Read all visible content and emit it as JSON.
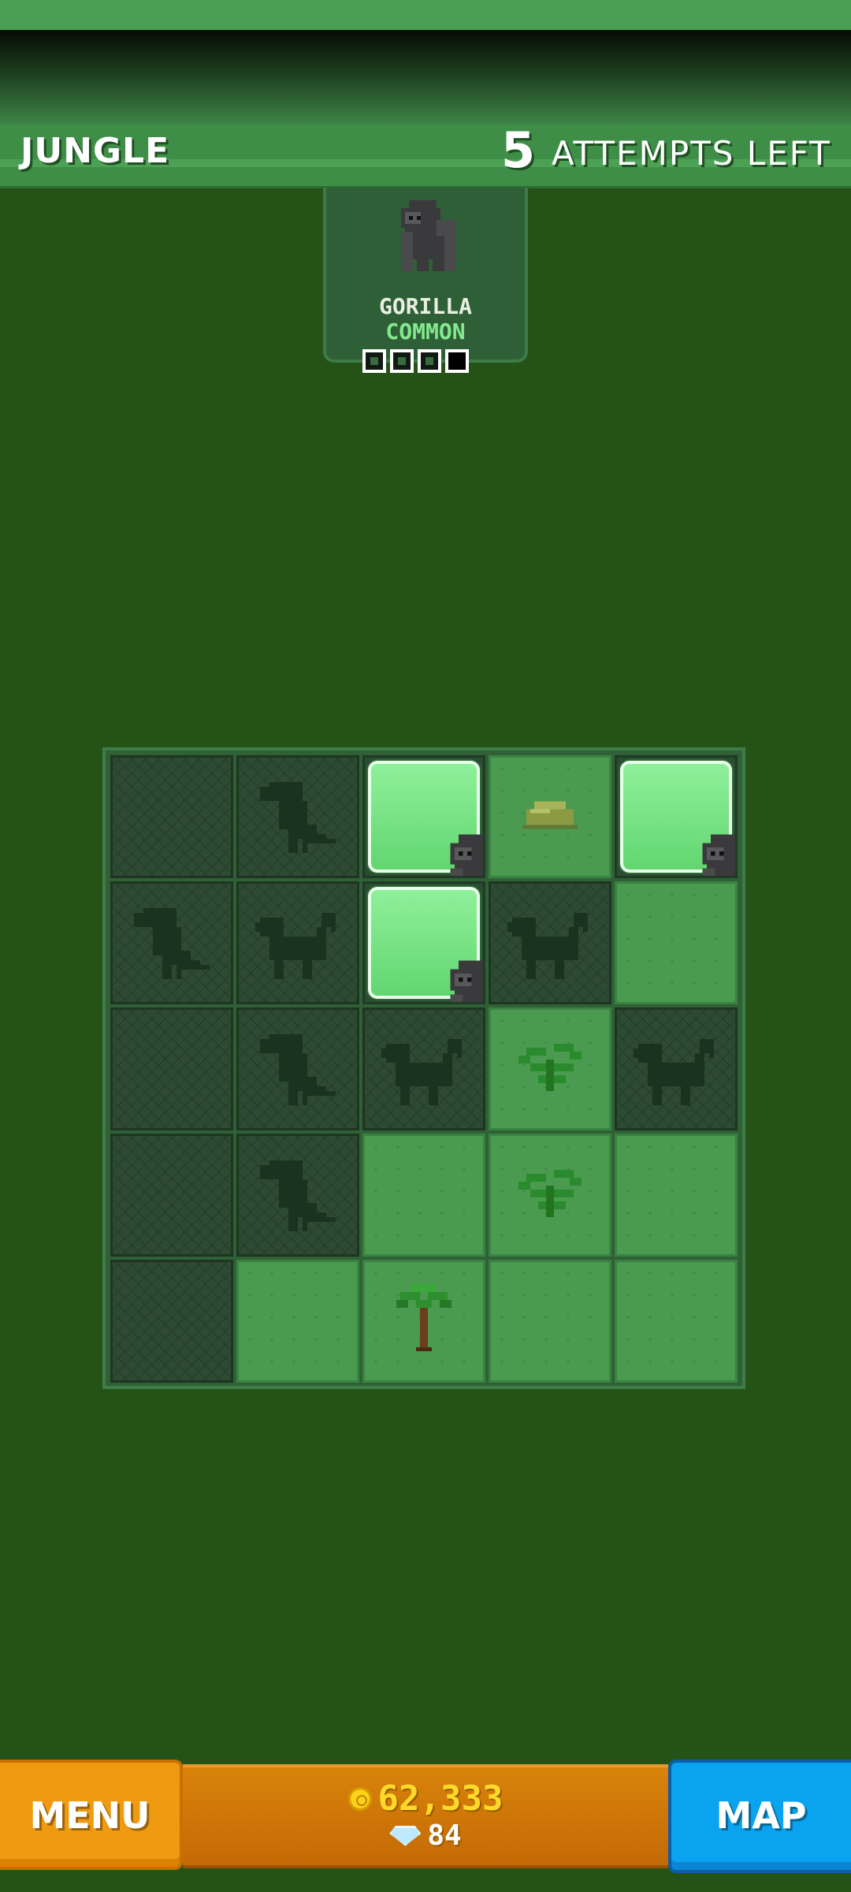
{
  "header": {
    "biome": "JUNGLE",
    "attempts_count": "5",
    "attempts_label": "ATTEMPTS LEFT"
  },
  "target": {
    "animal_name": "GORILLA",
    "rarity": "COMMON",
    "progress": {
      "found": 3,
      "total": 4
    },
    "rarity_color": "#84e98e"
  },
  "grid": {
    "rows": 5,
    "cols": 5,
    "cells": [
      [
        "hidden",
        "toucan-silhouette",
        "gorilla-found",
        "rock",
        "gorilla-found"
      ],
      [
        "toucan-silhouette",
        "monkey-silhouette",
        "gorilla-found",
        "monkey-silhouette",
        "empty"
      ],
      [
        "hidden",
        "toucan-silhouette",
        "monkey-silhouette",
        "fern",
        "monkey-silhouette"
      ],
      [
        "hidden",
        "toucan-silhouette",
        "empty",
        "fern",
        "empty"
      ],
      [
        "hidden",
        "empty",
        "palm-tree",
        "empty",
        "empty"
      ]
    ]
  },
  "footer": {
    "menu_label": "MENU",
    "map_label": "MAP",
    "coins": "62,333",
    "gems": "84"
  },
  "colors": {
    "background": "#255317",
    "header": "#3e8e48",
    "menu_button": "#ef9a10",
    "map_button": "#0aa3ef",
    "currency_panel": "#d8830a",
    "coin_text": "#ffd92a"
  }
}
